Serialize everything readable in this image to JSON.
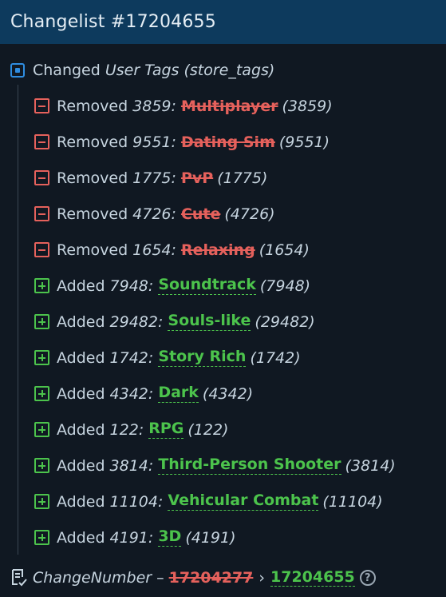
{
  "header": {
    "title": "Changelist #17204655"
  },
  "group": {
    "prefix": "Changed",
    "field": "User Tags (store_tags)"
  },
  "changes": [
    {
      "kind": "removed",
      "verb": "Removed",
      "id": "3859",
      "tag": "Multiplayer",
      "id_paren": "(3859)"
    },
    {
      "kind": "removed",
      "verb": "Removed",
      "id": "9551",
      "tag": "Dating Sim",
      "id_paren": "(9551)"
    },
    {
      "kind": "removed",
      "verb": "Removed",
      "id": "1775",
      "tag": "PvP",
      "id_paren": "(1775)"
    },
    {
      "kind": "removed",
      "verb": "Removed",
      "id": "4726",
      "tag": "Cute",
      "id_paren": "(4726)"
    },
    {
      "kind": "removed",
      "verb": "Removed",
      "id": "1654",
      "tag": "Relaxing",
      "id_paren": "(1654)"
    },
    {
      "kind": "added",
      "verb": "Added",
      "id": "7948",
      "tag": "Soundtrack",
      "id_paren": "(7948)"
    },
    {
      "kind": "added",
      "verb": "Added",
      "id": "29482",
      "tag": "Souls-like",
      "id_paren": "(29482)"
    },
    {
      "kind": "added",
      "verb": "Added",
      "id": "1742",
      "tag": "Story Rich",
      "id_paren": "(1742)"
    },
    {
      "kind": "added",
      "verb": "Added",
      "id": "4342",
      "tag": "Dark",
      "id_paren": "(4342)"
    },
    {
      "kind": "added",
      "verb": "Added",
      "id": "122",
      "tag": "RPG",
      "id_paren": "(122)"
    },
    {
      "kind": "added",
      "verb": "Added",
      "id": "3814",
      "tag": "Third-Person Shooter",
      "id_paren": "(3814)"
    },
    {
      "kind": "added",
      "verb": "Added",
      "id": "11104",
      "tag": "Vehicular Combat",
      "id_paren": "(11104)"
    },
    {
      "kind": "added",
      "verb": "Added",
      "id": "4191",
      "tag": "3D",
      "id_paren": "(4191)"
    }
  ],
  "footer": {
    "field": "ChangeNumber",
    "dash": "–",
    "old_value": "17204277",
    "arrow": "›",
    "new_value": "17204655",
    "help": "?"
  },
  "colors": {
    "removed": "#e5615c",
    "added": "#4cc34c",
    "header_bg": "#0d3a5d",
    "accent": "#2f8de0"
  },
  "icons": {
    "group": "changed-square-icon",
    "removed": "minus-square-icon",
    "added": "plus-square-icon",
    "footer": "document-check-icon",
    "help": "question-circle-icon"
  }
}
